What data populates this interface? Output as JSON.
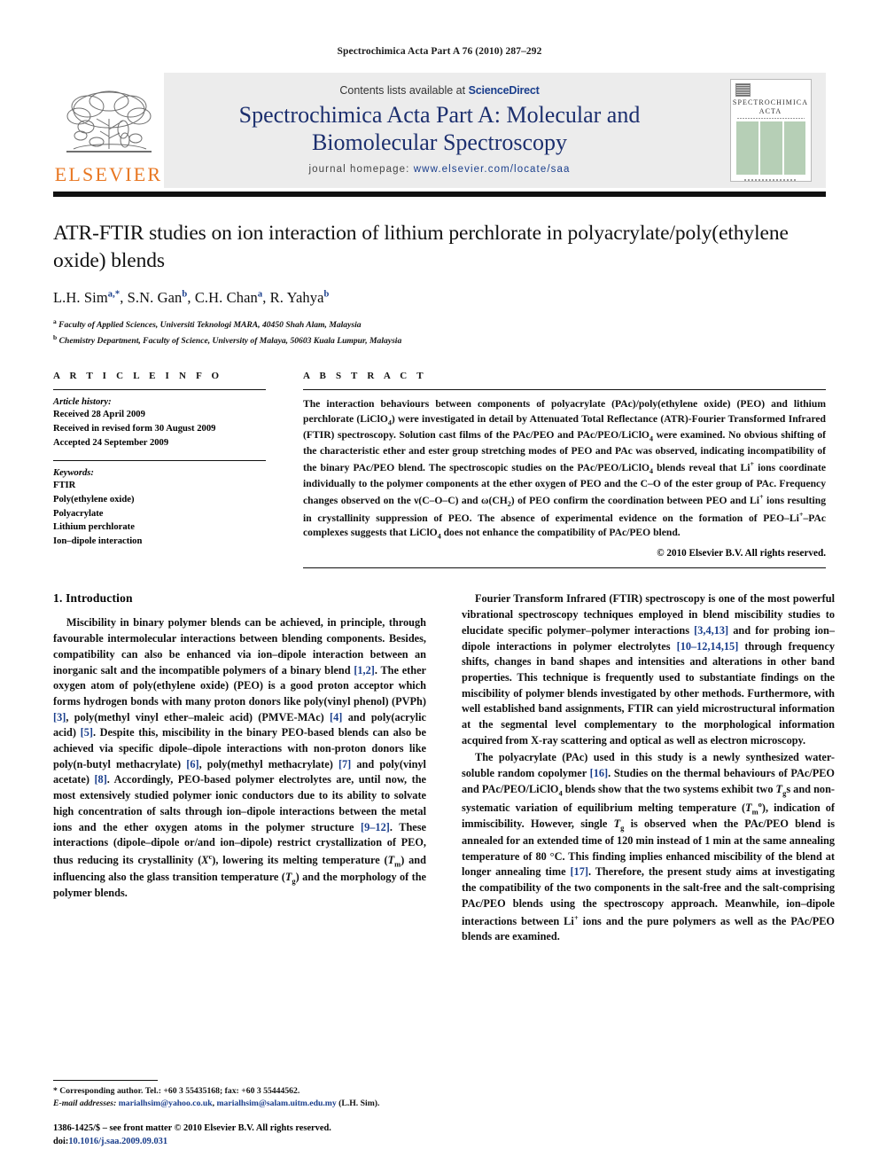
{
  "running_head": "Spectrochimica Acta Part A 76 (2010) 287–292",
  "masthead": {
    "publisher_logo_word": "ELSEVIER",
    "contents_prefix": "Contents lists available at ",
    "contents_link": "ScienceDirect",
    "journal_title_line1": "Spectrochimica Acta Part A: Molecular and",
    "journal_title_line2": "Biomolecular Spectroscopy",
    "homepage_prefix": "journal homepage:",
    "homepage_url": "www.elsevier.com/locate/saa",
    "cover_title_line1": "SPECTROCHIMICA",
    "cover_title_line2": "ACTA"
  },
  "article": {
    "title": "ATR-FTIR studies on ion interaction of lithium perchlorate in polyacrylate/poly(ethylene oxide) blends",
    "authors_html": "L.H. Sim<sup>a,*</sup>, S.N. Gan<sup>b</sup>, C.H. Chan<sup>a</sup>, R. Yahya<sup>b</sup>",
    "affiliation_a": "Faculty of Applied Sciences, Universiti Teknologi MARA, 40450 Shah Alam, Malaysia",
    "affiliation_b": "Chemistry Department, Faculty of Science, University of Malaya, 50603 Kuala Lumpur, Malaysia"
  },
  "article_info": {
    "heading": "A R T I C L E    I N F O",
    "history_label": "Article history:",
    "history": [
      "Received 28 April 2009",
      "Received in revised form 30 August 2009",
      "Accepted 24 September 2009"
    ],
    "keywords_label": "Keywords:",
    "keywords": [
      "FTIR",
      "Poly(ethylene oxide)",
      "Polyacrylate",
      "Lithium perchlorate",
      "Ion–dipole interaction"
    ]
  },
  "abstract": {
    "heading": "A B S T R A C T",
    "body_html": "The interaction behaviours between components of polyacrylate (PAc)/poly(ethylene oxide) (PEO) and lithium perchlorate (LiClO<sub>4</sub>) were investigated in detail by Attenuated Total Reflectance (ATR)-Fourier Transformed Infrared (FTIR) spectroscopy. Solution cast films of the PAc/PEO and PAc/PEO/LiClO<sub>4</sub> were examined. No obvious shifting of the characteristic ether and ester group stretching modes of PEO and PAc was observed, indicating incompatibility of the binary PAc/PEO blend. The spectroscopic studies on the PAc/PEO/LiClO<sub>4</sub> blends reveal that Li<sup>+</sup> ions coordinate individually to the polymer components at the ether oxygen of PEO and the C–O of the ester group of PAc. Frequency changes observed on the ν(C–O–C) and ω(CH<sub>2</sub>) of PEO confirm the coordination between PEO and Li<sup>+</sup> ions resulting in crystallinity suppression of PEO. The absence of experimental evidence on the formation of PEO–Li<sup>+</sup>–PAc complexes suggests that LiClO<sub>4</sub> does not enhance the compatibility of PAc/PEO blend.",
    "copyright": "© 2010 Elsevier B.V. All rights reserved."
  },
  "sections": {
    "intro_heading": "1.  Introduction",
    "left_para_1_html": "Miscibility in binary polymer blends can be achieved, in principle, through favourable intermolecular interactions between blending components. Besides, compatibility can also be enhanced via ion–dipole interaction between an inorganic salt and the incompatible polymers of a binary blend <span class=\"ref\">[1,2]</span>. The ether oxygen atom of poly(ethylene oxide) (PEO) is a good proton acceptor which forms hydrogen bonds with many proton donors like poly(vinyl phenol) (PVPh) <span class=\"ref\">[3]</span>, poly(methyl vinyl ether–maleic acid) (PMVE-MAc) <span class=\"ref\">[4]</span> and poly(acrylic acid) <span class=\"ref\">[5]</span>. Despite this, miscibility in the binary PEO-based blends can also be achieved via specific dipole–dipole interactions with non-proton donors like poly(n-butyl methacrylate) <span class=\"ref\">[6]</span>, poly(methyl methacrylate) <span class=\"ref\">[7]</span> and poly(vinyl acetate) <span class=\"ref\">[8]</span>. Accordingly, PEO-based polymer electrolytes are, until now, the most extensively studied polymer ionic conductors due to its ability to solvate high concentration of salts through ion–dipole interactions between the metal ions and the ether oxygen atoms in the polymer structure <span class=\"ref\">[9–12]</span>. These interactions (dipole–dipole or/and ion–dipole) restrict crystallization of PEO, thus reducing its crystallinity (<i>X</i><sup>c</sup>), lowering its melting temperature (<i>T</i><sub>m</sub>) and influencing also the glass transition temperature (<i>T</i><sub>g</sub>) and the morphology of the polymer blends.",
    "right_para_1_html": "Fourier Transform Infrared (FTIR) spectroscopy is one of the most powerful vibrational spectroscopy techniques employed in blend miscibility studies to elucidate specific polymer–polymer interactions <span class=\"ref\">[3,4,13]</span> and for probing ion–dipole interactions in polymer electrolytes <span class=\"ref\">[10–12,14,15]</span> through frequency shifts, changes in band shapes and intensities and alterations in other band properties. This technique is frequently used to substantiate findings on the miscibility of polymer blends investigated by other methods. Furthermore, with well established band assignments, FTIR can yield microstructural information at the segmental level complementary to the morphological information acquired from X-ray scattering and optical as well as electron microscopy.",
    "right_para_2_html": "The polyacrylate (PAc) used in this study is a newly synthesized water-soluble random copolymer <span class=\"ref\">[16]</span>. Studies on the thermal behaviours of PAc/PEO and PAc/PEO/LiClO<sub>4</sub> blends show that the two systems exhibit two <i>T</i><sub>g</sub>s and non-systematic variation of equilibrium melting temperature (<i>T</i><sub>m</sub><sup>o</sup>), indication of immiscibility. However, single <i>T</i><sub>g</sub> is observed when the PAc/PEO blend is annealed for an extended time of 120 min instead of 1 min at the same annealing temperature of 80 °C. This finding implies enhanced miscibility of the blend at longer annealing time <span class=\"ref\">[17]</span>. Therefore, the present study aims at investigating the compatibility of the two components in the salt-free and the salt-comprising PAc/PEO blends using the spectroscopy approach. Meanwhile, ion–dipole interactions between Li<sup>+</sup> ions and the pure polymers as well as the PAc/PEO blends are examined."
  },
  "footnotes": {
    "corresponding_html": "* Corresponding author. Tel.: +60 3 55435168; fax: +60 3 55444562.",
    "email_html": "<span class=\"em\">E-mail addresses:</span> <span class=\"fn-link\">marialhsim@yahoo.co.uk</span>, <span class=\"fn-link\">marialhsim@salam.uitm.edu.my</span> (L.H. Sim).",
    "imprint_html": "1386-1425/$ – see front matter © 2010 Elsevier B.V. All rights reserved.<br>doi:<span class=\"doi-link\">10.1016/j.saa.2009.09.031</span>"
  },
  "colors": {
    "elsevier_orange": "#E87722",
    "journal_blue": "#1c2f6e",
    "link_blue": "#1a3e8c",
    "masthead_grey": "#ececec",
    "cover_green": "#b6cfb6"
  }
}
